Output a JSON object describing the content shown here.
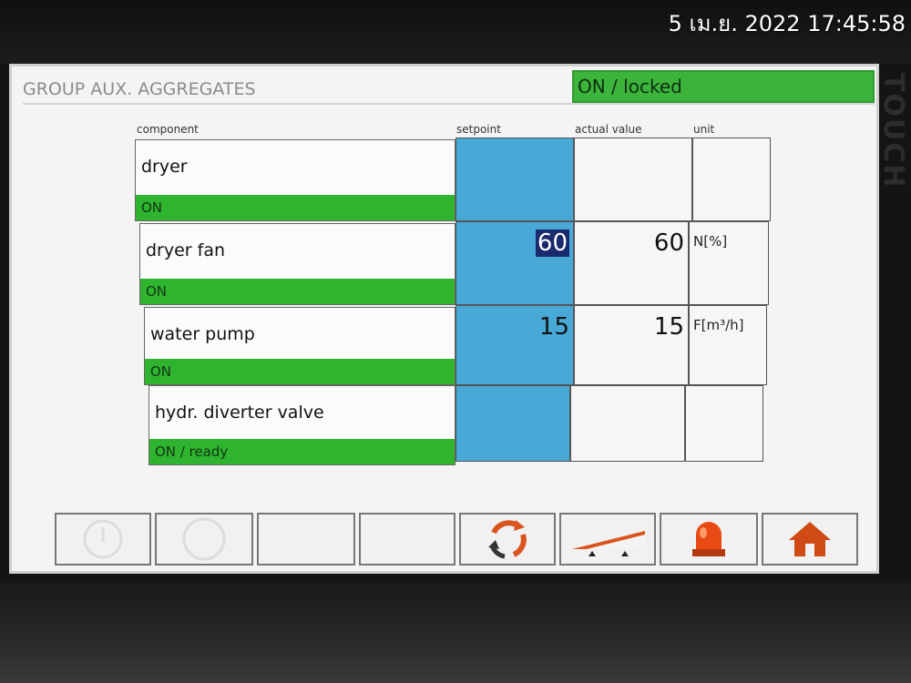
{
  "overlay": {
    "timestamp": "5 เม.ย. 2022 17:45:58",
    "brand": "TOUCH"
  },
  "header": {
    "title": "GROUP AUX. AGGREGATES",
    "status": "ON / locked"
  },
  "columns": {
    "component": "component",
    "setpoint": "setpoint",
    "actual": "actual value",
    "unit": "unit"
  },
  "rows": [
    {
      "name": "dryer",
      "state": "ON",
      "setpoint": "",
      "actual": "",
      "unit": ""
    },
    {
      "name": "dryer fan",
      "state": "ON",
      "setpoint": "60",
      "actual": "60",
      "unit": "N[%]"
    },
    {
      "name": "water pump",
      "state": "ON",
      "setpoint": "15",
      "actual": "15",
      "unit": "F[m³/h]"
    },
    {
      "name": "hydr. diverter valve",
      "state": "ON / ready",
      "setpoint": "",
      "actual": "",
      "unit": ""
    }
  ],
  "toolbar": {
    "buttons": [
      {
        "icon": "power-icon",
        "enabled": false
      },
      {
        "icon": "circle-icon",
        "enabled": false
      },
      {
        "icon": "",
        "enabled": true
      },
      {
        "icon": "",
        "enabled": true
      },
      {
        "icon": "refresh-cycle-icon",
        "enabled": true
      },
      {
        "icon": "ramp-icon",
        "enabled": true
      },
      {
        "icon": "alarm-beacon-icon",
        "enabled": true
      },
      {
        "icon": "home-icon",
        "enabled": true
      }
    ]
  },
  "colors": {
    "status_green": "#3cb43c",
    "setpoint_blue": "#48a9d6",
    "icon_orange": "#d9541e"
  }
}
